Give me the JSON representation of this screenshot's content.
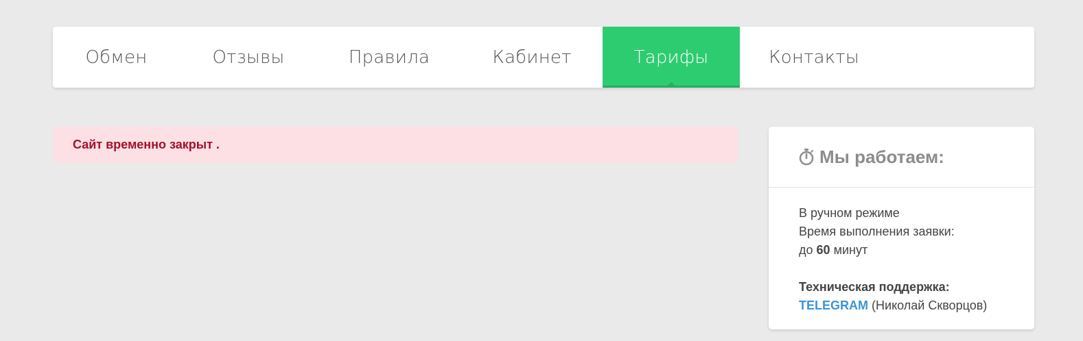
{
  "nav": {
    "items": [
      {
        "label": "Обмен",
        "active": false
      },
      {
        "label": "Отзывы",
        "active": false
      },
      {
        "label": "Правила",
        "active": false
      },
      {
        "label": "Кабинет",
        "active": false
      },
      {
        "label": "Тарифы",
        "active": true
      },
      {
        "label": "Контакты",
        "active": false
      }
    ]
  },
  "alert": {
    "text": "Сайт временно закрыт ."
  },
  "sidebar": {
    "icon": "stopwatch-icon",
    "title": "Мы работаем:",
    "mode": "В ручном режиме",
    "time_label": "Время выполнения заявки:",
    "time_prefix": "до",
    "time_value": "60",
    "time_unit": "минут",
    "support_label": "Техническая поддержка:",
    "support_link": "TELEGRAM",
    "support_name": "(Николай Скворцов)"
  },
  "colors": {
    "background": "#eaeaea",
    "accent": "#2ecc71",
    "alert_bg": "#fde0e4",
    "alert_text": "#a3112b",
    "link": "#3a94d8"
  }
}
